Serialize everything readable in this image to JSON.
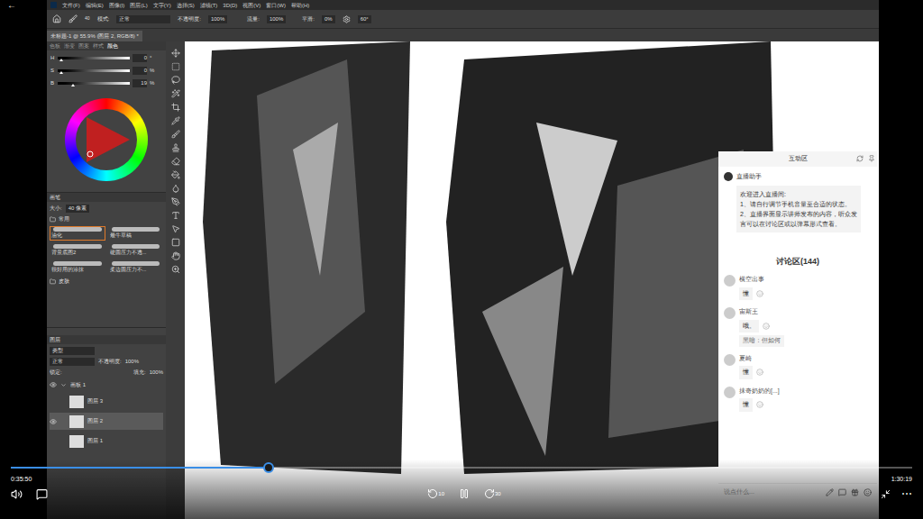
{
  "player": {
    "back": "←",
    "current": "0:35:50",
    "total": "1:30:19",
    "level": 0.286,
    "rewind": "10",
    "forward": "30",
    "more": "⋯"
  },
  "app": {
    "menu": [
      "文件(F)",
      "编辑(E)",
      "图像(I)",
      "图层(L)",
      "文字(Y)",
      "选择(S)",
      "滤镜(T)",
      "3D(D)",
      "视图(V)",
      "窗口(W)",
      "帮助(H)"
    ],
    "options": {
      "mode_label": "模式:",
      "mode": "正常",
      "opacity_label": "不透明度:",
      "opacity": "100%",
      "flow_label": "流量:",
      "flow": "100%",
      "smooth_label": "平滑:",
      "smooth": "0%",
      "angle": "60°",
      "brush_size": "40"
    },
    "doc_tab": "未标题-1 @ 55.9% (图层 2, RGB/8) *",
    "color": {
      "tabs": [
        {
          "label": "色板",
          "selected": false
        },
        {
          "label": "渐变",
          "selected": false
        },
        {
          "label": "图案",
          "selected": false
        },
        {
          "label": "样式",
          "selected": false
        },
        {
          "label": "颜色",
          "selected": true
        }
      ],
      "sliders": [
        {
          "label": "H",
          "value": "0",
          "unit": "°",
          "level": 0.02
        },
        {
          "label": "S",
          "value": "0",
          "unit": "%",
          "level": 0.02
        },
        {
          "label": "B",
          "value": "19",
          "unit": "%",
          "level": 0.19
        }
      ]
    },
    "brushes": {
      "title": "画笔",
      "size_label": "大小:",
      "size": "40 像素",
      "group": "常用",
      "items": [
        {
          "label": "油化",
          "selected": true
        },
        {
          "label": "最牛草稿",
          "selected": false
        },
        {
          "label": "背景底图2",
          "selected": false
        },
        {
          "label": "硬圆压力不透...",
          "selected": false
        },
        {
          "label": "很好用的涂抹",
          "selected": false
        },
        {
          "label": "柔边圆压力不...",
          "selected": false
        }
      ],
      "folder": "皮肤"
    },
    "layers": {
      "title": "图层",
      "filter": "类型",
      "blend": "正常",
      "opacity_label": "不透明度:",
      "opacity": "100%",
      "lock_label": "锁定:",
      "fill_label": "填充:",
      "fill": "100%",
      "artboard": "画板 1",
      "items": [
        {
          "name": "图层 3",
          "visible": false,
          "selected": false
        },
        {
          "name": "图层 2",
          "visible": true,
          "selected": true
        },
        {
          "name": "图层 1",
          "visible": false,
          "selected": false
        }
      ]
    }
  },
  "chat": {
    "title": "互动区",
    "helper": {
      "name": "直播助手",
      "text": "欢迎进入直播间:\n1、请自行调节手机音量至合适的状态。\n2、直播界面显示讲师发布的内容，听众发言可以在讨论区或以弹幕形式查看。"
    },
    "discussion": "讨论区(144)",
    "messages": [
      {
        "user": "横空出事",
        "text": "懂",
        "reply": ""
      },
      {
        "user": "宙斯王",
        "text": "哦。",
        "reply": "黑暗：但如何"
      },
      {
        "user": "夏崎",
        "text": "懂",
        "reply": ""
      },
      {
        "user": "抹奇奶奶的[...]",
        "text": "懂",
        "reply": ""
      }
    ],
    "input": "说点什么..."
  }
}
